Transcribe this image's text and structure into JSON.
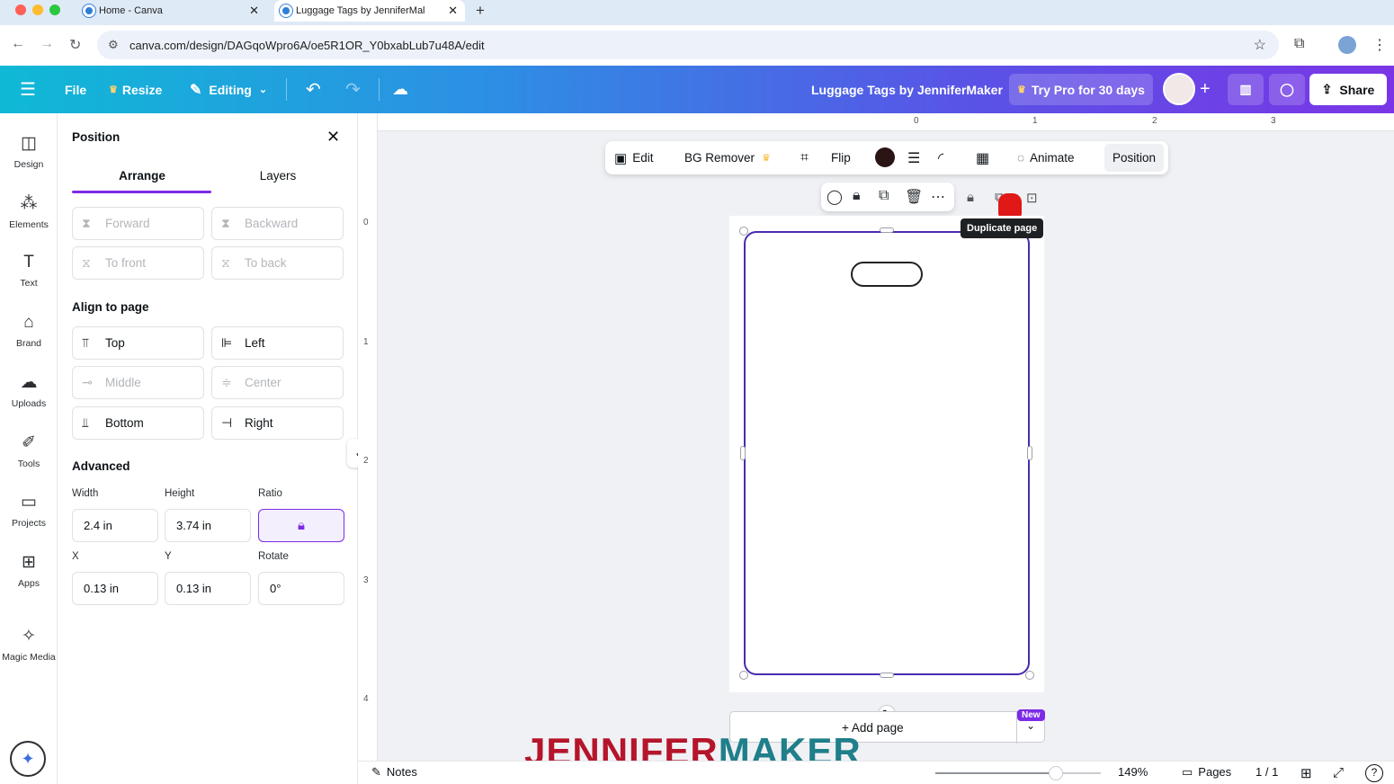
{
  "browser": {
    "tabs": [
      {
        "title": "Home - Canva"
      },
      {
        "title": "Luggage Tags by JenniferMal"
      }
    ],
    "url": "canva.com/design/DAGqoWpro6A/oe5R1OR_Y0bxabLub7u48A/edit"
  },
  "topbar": {
    "file": "File",
    "resize": "Resize",
    "editing": "Editing",
    "doc_title": "Luggage Tags by JenniferMaker",
    "try_pro": "Try Pro for 30 days",
    "share": "Share"
  },
  "sidebar": {
    "items": [
      {
        "label": "Design",
        "icon": "design-icon"
      },
      {
        "label": "Elements",
        "icon": "elements-icon"
      },
      {
        "label": "Text",
        "icon": "text-icon"
      },
      {
        "label": "Brand",
        "icon": "brand-icon"
      },
      {
        "label": "Uploads",
        "icon": "uploads-icon"
      },
      {
        "label": "Tools",
        "icon": "tools-icon"
      },
      {
        "label": "Projects",
        "icon": "projects-icon"
      },
      {
        "label": "Apps",
        "icon": "apps-icon"
      },
      {
        "label": "Magic Media",
        "icon": "magic-media-icon"
      }
    ]
  },
  "panel": {
    "title": "Position",
    "tabs": [
      "Arrange",
      "Layers"
    ],
    "arrange": {
      "forward": "Forward",
      "backward": "Backward",
      "to_front": "To front",
      "to_back": "To back"
    },
    "align_heading": "Align to page",
    "align": {
      "top": "Top",
      "left": "Left",
      "middle": "Middle",
      "center": "Center",
      "bottom": "Bottom",
      "right": "Right"
    },
    "advanced_heading": "Advanced",
    "labels": {
      "width": "Width",
      "height": "Height",
      "ratio": "Ratio",
      "x": "X",
      "y": "Y",
      "rotate": "Rotate"
    },
    "values": {
      "width": "2.4 in",
      "height": "3.74 in",
      "x": "0.13 in",
      "y": "0.13 in",
      "rotate": "0°"
    }
  },
  "ruler": {
    "top": [
      "0",
      "1",
      "2",
      "3"
    ],
    "left": [
      "0",
      "1",
      "2",
      "3",
      "4"
    ]
  },
  "toolbar": {
    "edit": "Edit",
    "bg_remover": "BG Remover",
    "flip": "Flip",
    "animate": "Animate",
    "position": "Position",
    "color": "#2a1414"
  },
  "tooltip": "Duplicate page",
  "add_page": {
    "label": "+ Add page",
    "badge": "New"
  },
  "bottombar": {
    "notes": "Notes",
    "zoom": "149%",
    "pages": "Pages",
    "page_count": "1 / 1",
    "zoom_level": 0.73
  },
  "watermark": {
    "part1": "JENNIFER",
    "part2": "MAKER"
  },
  "colors": {
    "accent": "#7d2ae8",
    "selection": "#4b2bb0"
  }
}
